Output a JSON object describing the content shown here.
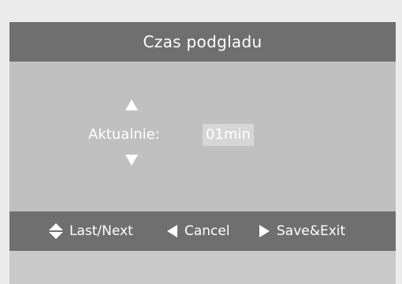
{
  "dialog": {
    "title": "Czas podgladu",
    "current_label": "Aktualnie:",
    "current_value": "01min"
  },
  "footer": {
    "nav_hint": "Last/Next",
    "cancel_hint": "Cancel",
    "save_hint": "Save&Exit"
  },
  "icons": {
    "value_up": "triangle-up-icon",
    "value_down": "triangle-down-icon",
    "nav": "up-down-arrows-icon",
    "cancel": "triangle-left-icon",
    "save": "triangle-right-icon"
  },
  "colors": {
    "title_bar": "#6f6f6f",
    "content": "#c0c0c0",
    "value_highlight": "#d6d6d6",
    "text": "#ffffff"
  }
}
